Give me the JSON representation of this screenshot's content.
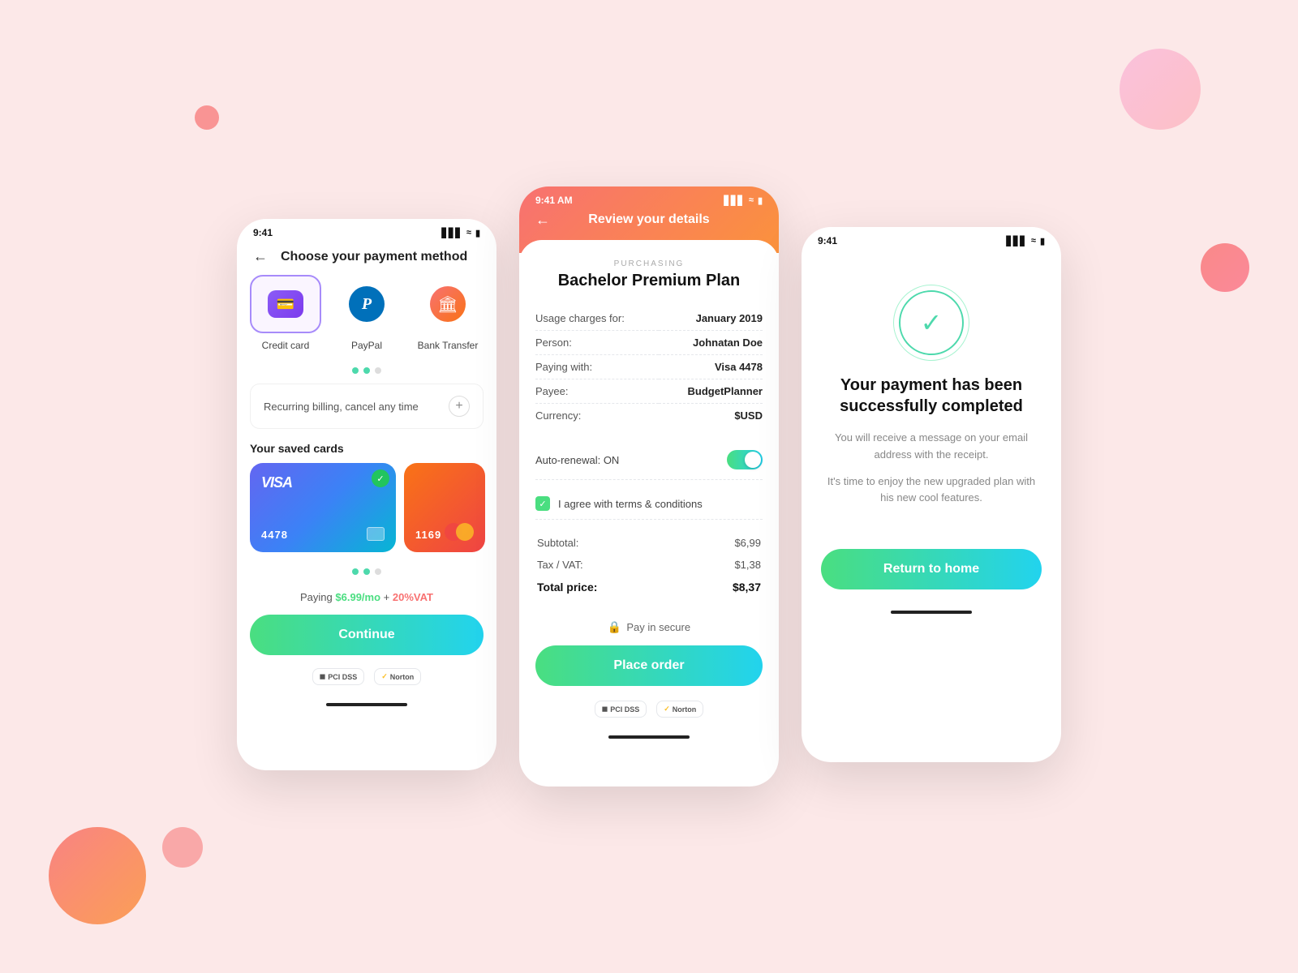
{
  "background": {
    "color": "#fce8e8"
  },
  "phone1": {
    "status_bar": {
      "time": "9:41",
      "battery": "100%"
    },
    "nav": {
      "title": "Choose your payment method"
    },
    "payment_methods": [
      {
        "id": "credit-card",
        "label": "Credit card",
        "selected": true
      },
      {
        "id": "paypal",
        "label": "PayPal",
        "selected": false
      },
      {
        "id": "bank-transfer",
        "label": "Bank Transfer",
        "selected": false
      }
    ],
    "billing": {
      "text": "Recurring billing, cancel any time"
    },
    "saved_cards_title": "Your saved cards",
    "cards": [
      {
        "type": "visa",
        "number": "4478"
      },
      {
        "type": "mastercard",
        "number": "1169"
      }
    ],
    "paying_text": "Paying",
    "paying_amount": "$6.99/mo",
    "paying_separator": " + ",
    "paying_vat": "20%VAT",
    "continue_label": "Continue"
  },
  "phone2": {
    "status_bar": {
      "time": "9:41 AM"
    },
    "nav": {
      "title": "Review your details"
    },
    "purchasing_label": "PURCHASING",
    "plan_title": "Bachelor Premium Plan",
    "details": [
      {
        "label": "Usage charges for:",
        "value": "January 2019"
      },
      {
        "label": "Person:",
        "value": "Johnatan Doe"
      },
      {
        "label": "Paying with:",
        "value": "Visa 4478"
      },
      {
        "label": "Payee:",
        "value": "BudgetPlanner"
      },
      {
        "label": "Currency:",
        "value": "$USD"
      }
    ],
    "auto_renewal": {
      "label": "Auto-renewal: ON",
      "on": true
    },
    "terms": {
      "label": "I agree with terms & conditions",
      "checked": true
    },
    "pricing": [
      {
        "label": "Subtotal:",
        "value": "$6,99"
      },
      {
        "label": "Tax / VAT:",
        "value": "$1,38"
      },
      {
        "label": "Total price:",
        "value": "$8,37",
        "bold": true
      }
    ],
    "secure_label": "Pay in secure",
    "place_order_label": "Place order"
  },
  "phone3": {
    "status_bar": {
      "time": "9:41"
    },
    "success_title": "Your payment has been successfully completed",
    "success_desc1": "You will receive a message on your email address with the receipt.",
    "success_desc2": "It's time to enjoy the new upgraded plan with his new cool features.",
    "return_label": "Return to home"
  }
}
